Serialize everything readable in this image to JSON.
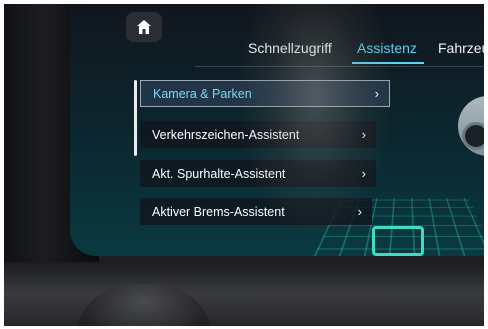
{
  "header": {
    "home_icon": "home-icon",
    "tabs": [
      {
        "label": "Schnellzugriff",
        "active": false
      },
      {
        "label": "Assistenz",
        "active": true
      },
      {
        "label": "Fahrzeu",
        "active": false
      }
    ]
  },
  "menu": {
    "items": [
      {
        "label": "Kamera & Parken",
        "selected": true
      },
      {
        "label": "Verkehrszeichen-Assistent",
        "selected": false
      },
      {
        "label": "Akt. Spurhalte-Assistent",
        "selected": false
      },
      {
        "label": "Aktiver Brems-Assistent",
        "selected": false
      }
    ],
    "chevron_icon": "chevron-right-icon"
  },
  "colors": {
    "accent": "#5fd1f0",
    "background": "#0b2730",
    "grid": "#3fdcc0"
  }
}
